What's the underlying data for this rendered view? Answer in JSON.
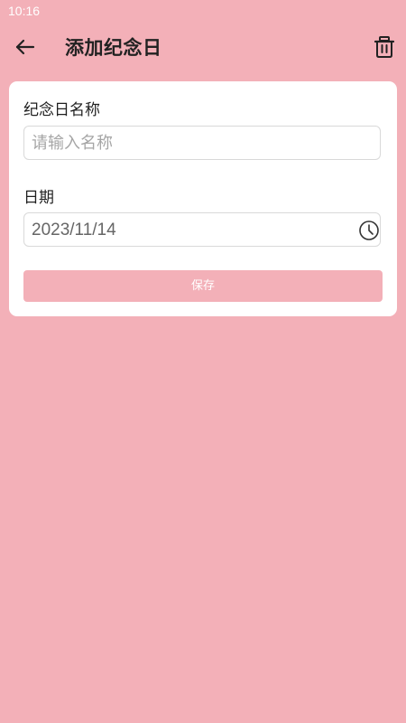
{
  "status_bar": {
    "time": "10:16"
  },
  "app_bar": {
    "title": "添加纪念日",
    "back_icon": "arrow-left-icon",
    "delete_icon": "trash-icon"
  },
  "form": {
    "name_label": "纪念日名称",
    "name_placeholder": "请输入名称",
    "name_value": "",
    "date_label": "日期",
    "date_value": "2023/11/14",
    "date_icon": "clock-icon",
    "save_label": "保存"
  },
  "colors": {
    "background": "#f3b0b8",
    "card": "#ffffff",
    "button": "#f3b0b8",
    "title_text": "#222222"
  }
}
